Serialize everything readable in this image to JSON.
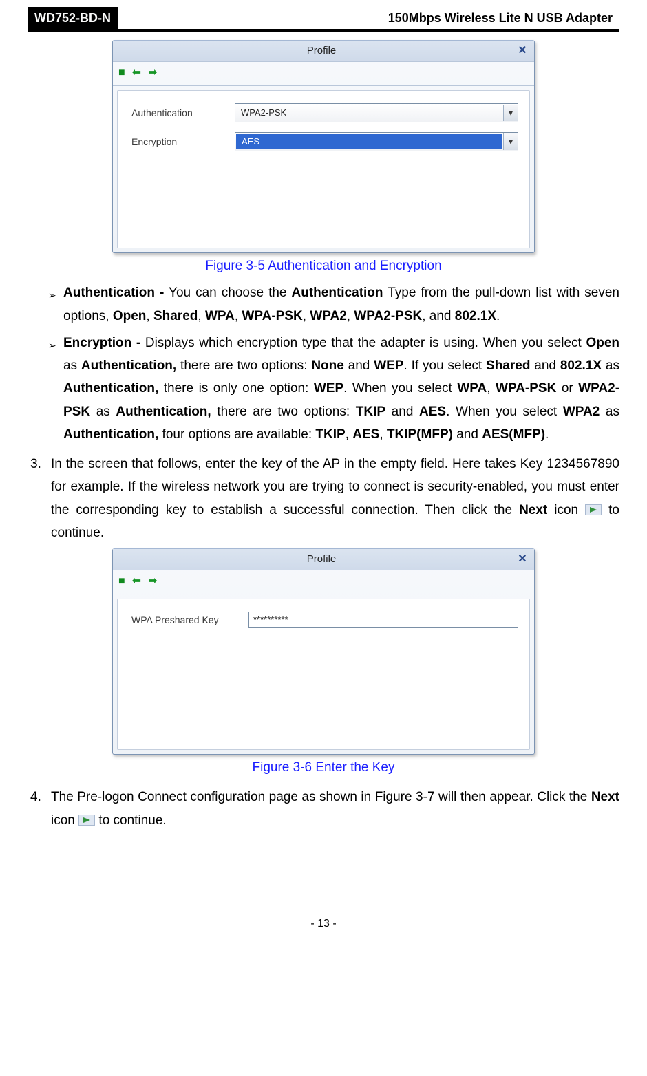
{
  "header": {
    "model": "WD752-BD-N",
    "subtitle": "150Mbps Wireless Lite N USB Adapter"
  },
  "fig1": {
    "window_title": "Profile",
    "auth_label": "Authentication",
    "enc_label": "Encryption",
    "auth_value": "WPA2-PSK",
    "enc_value": "AES",
    "caption": "Figure 3-5 Authentication and Encryption"
  },
  "bullets": {
    "auth_head": "Authentication -",
    "auth_text1": " You can choose the ",
    "auth_bold1": "Authentication",
    "auth_text2": " Type from the pull-down list with seven options, ",
    "open": "Open",
    "shared": "Shared",
    "wpa": "WPA",
    "wpapsk": "WPA-PSK",
    "wpa2": "WPA2",
    "wpa2psk": "WPA2-PSK",
    "dot1x": "802.1X",
    "period": ".",
    "enc_head": "Encryption -",
    "enc_t1": " Displays which encryption type that the adapter is using. When you select ",
    "enc_b1": "Open",
    "enc_t2": " as ",
    "enc_b2": "Authentication,",
    "enc_t3": " there are two options: ",
    "enc_b3": "None",
    "enc_t4": " and ",
    "enc_b4": "WEP",
    "enc_t5": ". If you select ",
    "enc_b5": "Shared",
    "enc_t6": " and ",
    "enc_b6": "802.1X",
    "enc_t7": " as ",
    "enc_b7": "Authentication,",
    "enc_t8": " there is only one option: ",
    "enc_b8": "WEP",
    "enc_t9": ". When you select ",
    "enc_b9": "WPA",
    "enc_t10": ", ",
    "enc_b10": "WPA-PSK",
    "enc_t11": " or ",
    "enc_b11": "WPA2-PSK",
    "enc_t12": " as ",
    "enc_b12": "Authentication,",
    "enc_t13": " there are two options: ",
    "enc_b13": "TKIP",
    "enc_t14": " and ",
    "enc_b14": "AES",
    "enc_t15": ". When you select ",
    "enc_b15": "WPA2",
    "enc_t16": " as ",
    "enc_b16": "Authentication,",
    "enc_t17": " four options are available: ",
    "enc_b17": "TKIP",
    "enc_b18": "AES",
    "enc_b19": "TKIP(MFP)",
    "enc_b20": "AES(MFP)"
  },
  "item3": {
    "num": "3.",
    "t1": "In the screen that follows, enter the key of the AP in the empty field. Here takes Key 1234567890 for example. If the wireless network you are trying to connect is security-enabled, you must enter the corresponding key to establish a successful connection. Then click the ",
    "b1": "Next",
    "t2": " icon ",
    "t3": " to continue."
  },
  "fig2": {
    "window_title": "Profile",
    "key_label": "WPA Preshared Key",
    "key_value": "**********",
    "caption": "Figure 3-6 Enter the Key"
  },
  "item4": {
    "num": "4.",
    "t1": "The Pre-logon Connect configuration page as shown in Figure 3-7 will then appear. Click the ",
    "b1": "Next",
    "t2": " icon ",
    "t3": " to continue."
  },
  "footer": {
    "pagenum": "- 13 -"
  }
}
